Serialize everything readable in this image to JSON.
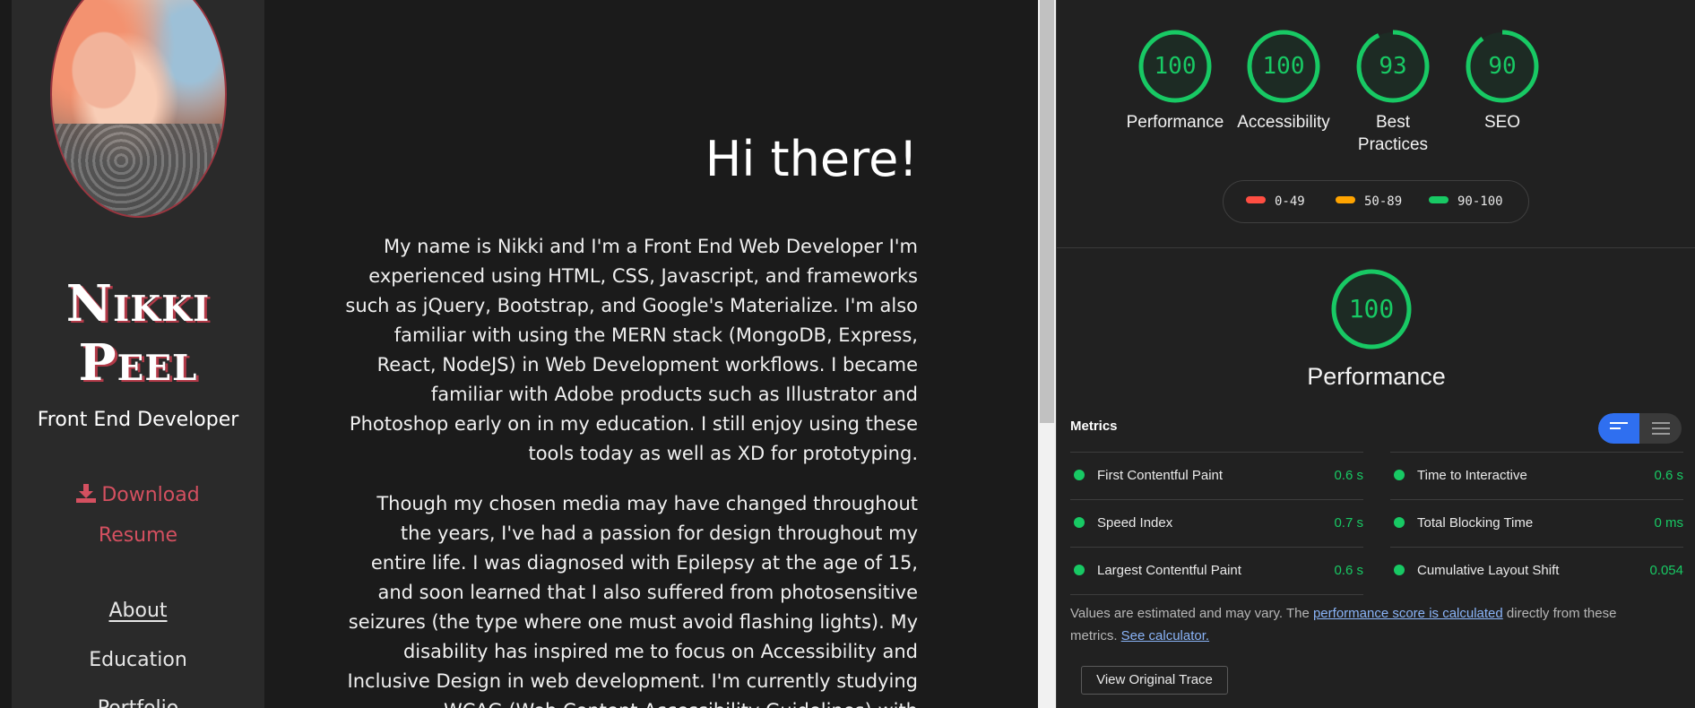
{
  "site": {
    "name_line1": "Nikki",
    "name_line2": "Peel",
    "role": "Front End Developer",
    "download_line1": "Download",
    "download_line2": "Resume",
    "nav": {
      "about": "About",
      "education": "Education",
      "portfolio": "Portfolio"
    },
    "greeting": "Hi there!",
    "bio1": "My name is Nikki and I'm a Front End Web Developer I'm experienced using HTML, CSS, Javascript, and frameworks such as jQuery, Bootstrap, and Google's Materialize. I'm also familiar with using the MERN stack (MongoDB, Express, React, NodeJS) in Web Development workflows. I became familiar with Adobe products such as Illustrator and Photoshop early on in my education. I still enjoy using these tools today as well as XD for prototyping.",
    "bio2": "Though my chosen media may have changed throughout the years, I've had a passion for design throughout my entire life. I was diagnosed with Epilepsy at the age of 15, and soon learned that I also suffered from photosensitive seizures (the type where one must avoid flashing lights). My disability has inspired me to focus on Accessibility and Inclusive Design in web development. I'm currently studying WCAG (Web Content Accessibility Guidelines) with",
    "accent_color": "#d45060",
    "sidebar_color": "#2a2a2a"
  },
  "lighthouse": {
    "gauges": [
      {
        "score": 100,
        "label": "Performance"
      },
      {
        "score": 100,
        "label": "Accessibility"
      },
      {
        "score": 93,
        "label": "Best Practices"
      },
      {
        "score": 90,
        "label": "SEO"
      }
    ],
    "legend": [
      {
        "range": "0-49",
        "color": "#ff4e42"
      },
      {
        "range": "50-89",
        "color": "#ffa400"
      },
      {
        "range": "90-100",
        "color": "#18c964"
      }
    ],
    "main_score": 100,
    "main_title": "Performance",
    "metrics_title": "Metrics",
    "metrics_left": [
      {
        "label": "First Contentful Paint",
        "value": "0.6 s"
      },
      {
        "label": "Speed Index",
        "value": "0.7 s"
      },
      {
        "label": "Largest Contentful Paint",
        "value": "0.6 s"
      }
    ],
    "metrics_right": [
      {
        "label": "Time to Interactive",
        "value": "0.6 s"
      },
      {
        "label": "Total Blocking Time",
        "value": "0 ms"
      },
      {
        "label": "Cumulative Layout Shift",
        "value": "0.054"
      }
    ],
    "note_prefix": "Values are estimated and may vary. The ",
    "note_link1": "performance score is calculated",
    "note_middle": " directly from these metrics. ",
    "note_link2": "See calculator.",
    "trace_button": "View Original Trace",
    "pass_color": "#18c964"
  }
}
